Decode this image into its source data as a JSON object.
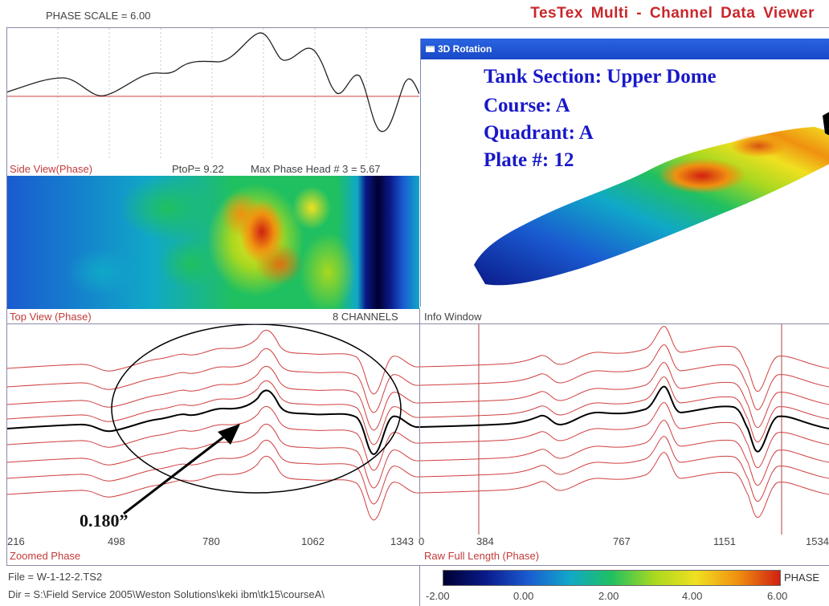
{
  "header": {
    "phase_scale": "PHASE SCALE = 6.00",
    "app_title": "TesTex  Multi - Channel  Data  Viewer"
  },
  "side_view": {
    "label": "Side View(Phase)",
    "ptop": "PtoP= 9.22",
    "max_phase": "Max Phase Head # 3 = 5.67"
  },
  "top_view": {
    "label": "Top View (Phase)",
    "channels": "8 CHANNELS"
  },
  "rotation_window": {
    "title": "3D Rotation",
    "tank_section": "Tank Section: Upper Dome",
    "course": "Course: A",
    "quadrant": "Quadrant: A",
    "plate": "Plate #: 12"
  },
  "info_window": {
    "label": "Info Window"
  },
  "zoomed_phase": {
    "label": "Zoomed Phase",
    "annotation": "0.180”",
    "ticks": [
      "216",
      "498",
      "780",
      "1062",
      "1343"
    ]
  },
  "raw_full_length": {
    "label": "Raw Full Length (Phase)",
    "ticks": [
      "0",
      "384",
      "767",
      "1151",
      "1534"
    ]
  },
  "status": {
    "file": "File = W-1-12-2.TS2",
    "dir": "Dir = S:\\Field Service 2005\\Weston Solutions\\keki ibm\\tk15\\courseA\\"
  },
  "color_scale": {
    "label": "PHASE",
    "ticks": [
      "-2.00",
      "0.00",
      "2.00",
      "4.00",
      "6.00"
    ],
    "colors": [
      "#000030",
      "#0a1a8a",
      "#1a5ad0",
      "#10a8c8",
      "#20c060",
      "#a8d820",
      "#f0e020",
      "#f09010",
      "#d02010"
    ]
  },
  "colors": {
    "title_red": "#c8262a",
    "trace_red": "#d04040",
    "window_blue": "#1848c8",
    "text_blue": "#1818c8"
  }
}
